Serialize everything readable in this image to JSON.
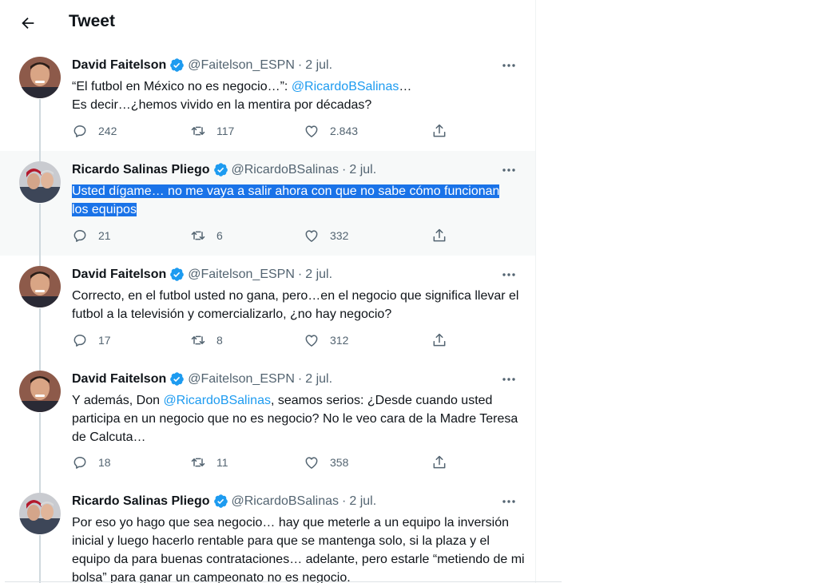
{
  "header": {
    "title": "Tweet"
  },
  "tweets": [
    {
      "name": "David Faitelson",
      "handle": "@Faitelson_ESPN",
      "date": "2 jul.",
      "body": {
        "p1": "“El futbol en México no es negocio…”: ",
        "mention": "@RicardoBSalinas",
        "p2": "…",
        "p3": "Es decir…¿hemos vivido en la mentira por décadas?"
      },
      "replies": "242",
      "retweets": "117",
      "likes": "2.843"
    },
    {
      "name": "Ricardo Salinas Pliego",
      "handle": "@RicardoBSalinas",
      "date": "2 jul.",
      "body": {
        "line1": "Usted dígame… no me vaya a salir ahora con que no sabe cómo funcionan",
        "line2": "los equipos"
      },
      "replies": "21",
      "retweets": "6",
      "likes": "332"
    },
    {
      "name": "David Faitelson",
      "handle": "@Faitelson_ESPN",
      "date": "2 jul.",
      "body": {
        "text": "Correcto, en el futbol usted no gana, pero…en el negocio que significa llevar el futbol a la televisión y comercializarlo, ¿no hay negocio?"
      },
      "replies": "17",
      "retweets": "8",
      "likes": "312"
    },
    {
      "name": "David Faitelson",
      "handle": "@Faitelson_ESPN",
      "date": "2 jul.",
      "body": {
        "p1": "Y además, Don ",
        "mention": "@RicardoBSalinas",
        "p2": ", seamos serios: ¿Desde cuando usted participa en un negocio que no es negocio? No le veo cara de la Madre Teresa de Calcuta…"
      },
      "replies": "18",
      "retweets": "11",
      "likes": "358"
    },
    {
      "name": "Ricardo Salinas Pliego",
      "handle": "@RicardoBSalinas",
      "date": "2 jul.",
      "body": {
        "text": "Por eso yo hago que sea negocio… hay que meterle a un equipo la inversión inicial y luego hacerlo rentable para que se mantenga solo, si la plaza y el equipo da para buenas contrataciones… adelante, pero estarle “metiendo de mi bolsa” para ganar un campeonato no es negocio."
      }
    }
  ],
  "colors": {
    "accent": "#1d9bf0",
    "selection": "#1a73e8",
    "muted": "#536471"
  }
}
